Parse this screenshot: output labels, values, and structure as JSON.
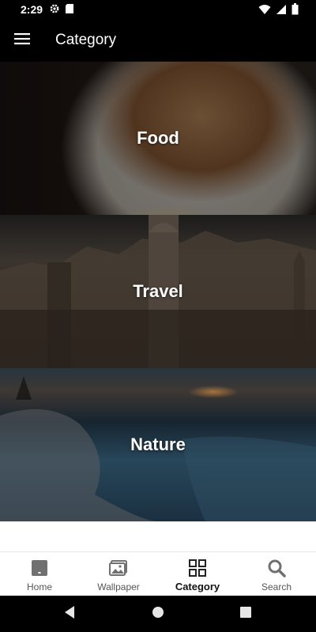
{
  "status_bar": {
    "time": "2:29",
    "icons": [
      "gear-icon",
      "sd-card-icon",
      "wifi-icon",
      "signal-icon",
      "battery-icon"
    ]
  },
  "app_bar": {
    "menu_icon": "hamburger-menu-icon",
    "title": "Category"
  },
  "categories": [
    {
      "label": "Food"
    },
    {
      "label": "Travel"
    },
    {
      "label": "Nature"
    }
  ],
  "bottom_nav": {
    "items": [
      {
        "label": "Home",
        "icon": "home-icon",
        "active": false
      },
      {
        "label": "Wallpaper",
        "icon": "wallpaper-icon",
        "active": false
      },
      {
        "label": "Category",
        "icon": "grid-icon",
        "active": true
      },
      {
        "label": "Search",
        "icon": "search-icon",
        "active": false
      }
    ]
  },
  "system_nav": {
    "buttons": [
      "back-icon",
      "home-circle-icon",
      "recents-icon"
    ]
  },
  "colors": {
    "bar_background": "#000000",
    "nav_background": "#ffffff",
    "active_label": "#111111",
    "inactive_label": "#555555"
  }
}
